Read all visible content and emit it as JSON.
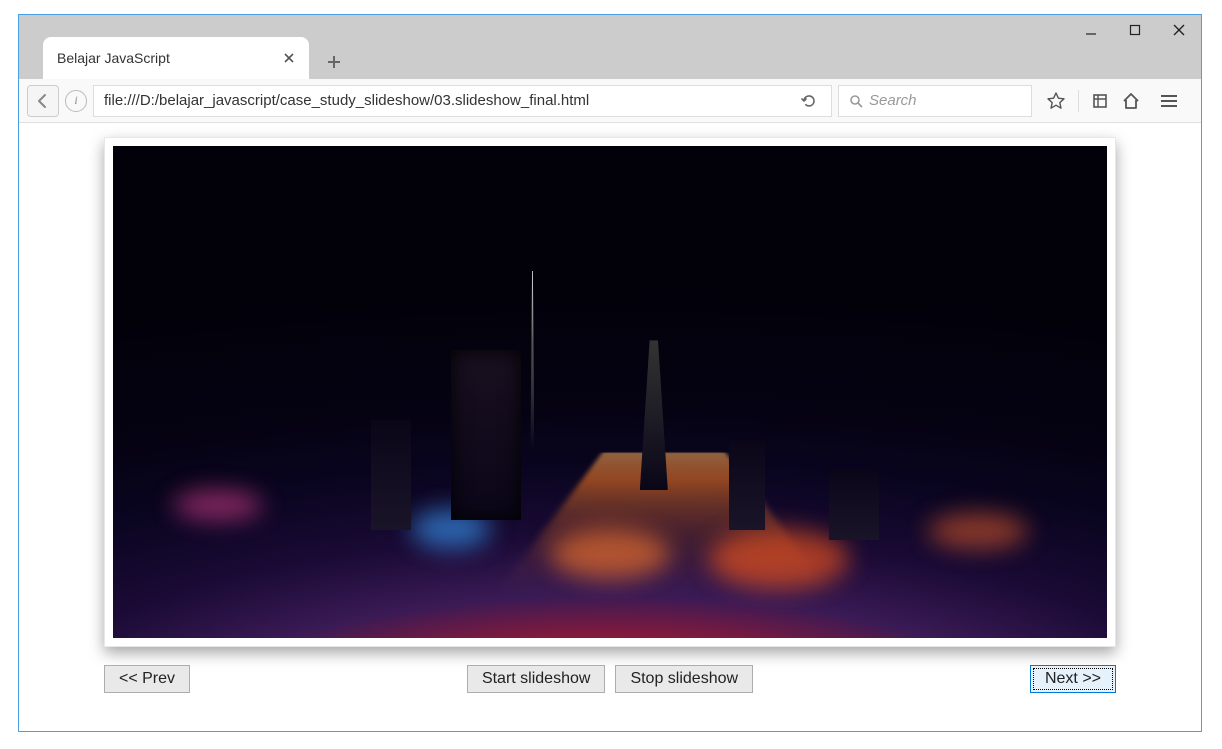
{
  "window": {
    "tab_title": "Belajar JavaScript"
  },
  "url_bar": {
    "value": "file:///D:/belajar_javascript/case_study_slideshow/03.slideshow_final.html"
  },
  "search": {
    "placeholder": "Search"
  },
  "slideshow": {
    "prev_label": "<< Prev",
    "start_label": "Start slideshow",
    "stop_label": "Stop slideshow",
    "next_label": "Next >>"
  }
}
